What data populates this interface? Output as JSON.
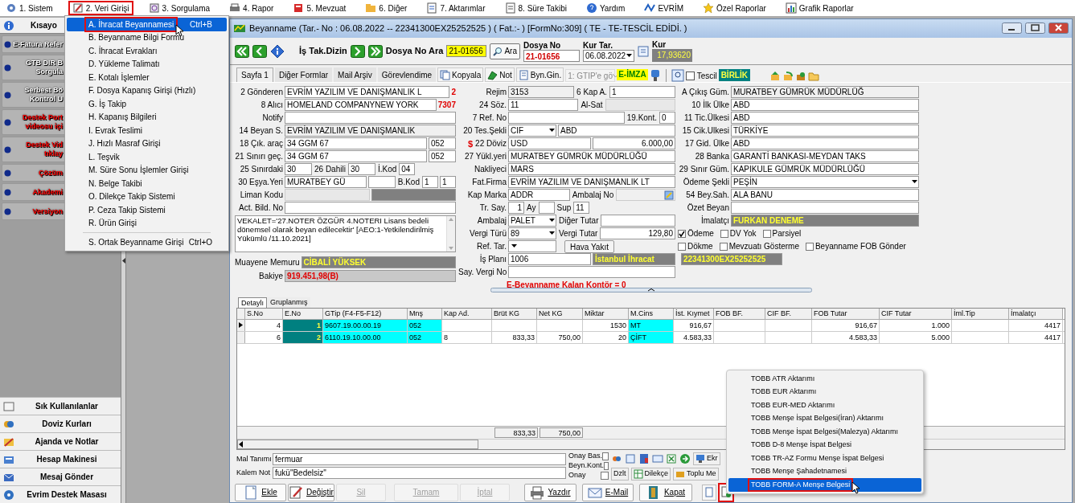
{
  "menubar": [
    {
      "label": "1.  Sistem",
      "selected": false
    },
    {
      "label": "2.  Veri Girişi",
      "selected": true
    },
    {
      "label": "3.  Sorgulama",
      "selected": false
    },
    {
      "label": "4.  Rapor",
      "selected": false
    },
    {
      "label": "5.  Mevzuat",
      "selected": false
    },
    {
      "label": "6.  Diğer",
      "selected": false
    },
    {
      "label": "7.  Aktarımlar",
      "selected": false
    },
    {
      "label": "8. Süre Takibi",
      "selected": false
    },
    {
      "label": "Yardım",
      "selected": false
    },
    {
      "label": "EVRİM",
      "selected": false
    },
    {
      "label": "Özel Raporlar",
      "selected": false
    },
    {
      "label": "Grafik Raporlar",
      "selected": false
    }
  ],
  "sidebar": {
    "title": "Kısayo",
    "items": [
      {
        "lines": [
          "E-Fatura Refer"
        ],
        "color": "#ffffff"
      },
      {
        "lines": [
          "GTB DIR B",
          "Sorgula"
        ],
        "color": "#ffffff"
      },
      {
        "lines": [
          "Serbest Bö",
          "Kontrol U"
        ],
        "color": "#ffffff"
      },
      {
        "lines": [
          "Destek Port",
          "videosu içi"
        ],
        "color": "#ff0000"
      },
      {
        "lines": [
          "Destek Vid",
          "tıklay"
        ],
        "color": "#ff0000"
      },
      {
        "lines": [
          "Çözüm"
        ],
        "color": "#ff0000"
      },
      {
        "lines": [
          "Akademi"
        ],
        "color": "#ff0000"
      },
      {
        "lines": [
          "Versiyon"
        ],
        "color": "#ff0000"
      }
    ],
    "bottom_items": [
      "Sık Kullanılanlar",
      "Doviz Kurları",
      "Ajanda ve Notlar",
      "Hesap Makinesi",
      "Mesaj Gönder",
      "Evrim Destek Masası"
    ]
  },
  "dropdown_menu": {
    "items": [
      {
        "key": "A.",
        "label": "İhracat Beyannamesi",
        "shortcut": "Ctrl+B",
        "selected": true
      },
      {
        "key": "B.",
        "label": "Beyanname Bilgi Formu",
        "selected": false
      },
      {
        "key": "C.",
        "label": "İhracat Evrakları",
        "selected": false
      },
      {
        "key": "D.",
        "label": "Yükleme Talimatı",
        "selected": false
      },
      {
        "key": "E.",
        "label": "Kotalı İşlemler",
        "selected": false
      },
      {
        "key": "F.",
        "label": "Dosya Kapanış Girişi (Hızlı)",
        "selected": false
      },
      {
        "key": "G.",
        "label": "İş Takip",
        "selected": false
      },
      {
        "key": "H.",
        "label": "Kapanış Bilgileri",
        "selected": false
      },
      {
        "key": "I.",
        "label": "Evrak Teslimi",
        "selected": false
      },
      {
        "key": "J.",
        "label": "Hızlı Masraf Girişi",
        "selected": false
      },
      {
        "key": "L.",
        "label": "Teşvik",
        "selected": false
      },
      {
        "key": "M.",
        "label": "Süre Sonu İşlemler Girişi",
        "selected": false
      },
      {
        "key": "N.",
        "label": "Belge Takibi",
        "selected": false
      },
      {
        "key": "O.",
        "label": "Dilekçe Takip Sistemi",
        "selected": false
      },
      {
        "key": "P.",
        "label": "Ceza Takip Sistemi",
        "selected": false
      },
      {
        "key": "R.",
        "label": "Ürün Girişi",
        "selected": false
      }
    ],
    "extra_items": [
      {
        "key": "S.",
        "label": "Ortak Beyanname Girişi",
        "shortcut": "Ctrl+O",
        "selected": false
      }
    ]
  },
  "window": {
    "title": "Beyanname (Tar.- No : 06.08.2022 -- 22341300EX25252525 ) ( Fat.:- )  [FormNo:309] ( TE - TE-TESCİL EDİDİ. )",
    "toolbar": {
      "dizin_label": "İş Tak.Dizin",
      "search_label": "Dosya No Ara",
      "search_value": "21-01656",
      "search_button": "Ara",
      "dosya_label": "Dosya No",
      "dosya_value": "21-01656",
      "kur_tar_label": "Kur Tar.",
      "kur_tar_value": "06.08.2022",
      "kur_label": "Kur",
      "kur_value": "17,93620"
    },
    "form_tabs": [
      {
        "label": "Sayfa 1",
        "selected": true
      },
      {
        "label": "Diğer Formlar",
        "selected": false
      },
      {
        "label": "Mail Arşiv",
        "selected": false
      },
      {
        "label": "Görevlendime",
        "selected": false
      }
    ],
    "form_tools": {
      "copy": "Kopyala",
      "note": "Not",
      "byn": "Byn.Gin.",
      "sort_combo": "1: GTIP'e gö",
      "eimza": "E-İMZA",
      "tescil": "Tescil",
      "tescil_checked": false,
      "birlik": "BİRLİK"
    },
    "columns": [
      [
        [
          {
            "kind": "label",
            "text": "2 Gönderen"
          },
          {
            "kind": "field",
            "value": "EVRİM YAZILIM VE DANIŞMANLIK L"
          },
          {
            "kind": "note",
            "text": "2"
          }
        ],
        [
          {
            "kind": "label",
            "text": "8 Alıcı"
          },
          {
            "kind": "field",
            "value": "HOMELAND COMPANYNEW YORK"
          },
          {
            "kind": "note",
            "text": "7307"
          }
        ],
        [
          {
            "kind": "label",
            "text": "Notify"
          },
          {
            "kind": "field"
          }
        ],
        [
          {
            "kind": "label",
            "text": "14 Beyan S."
          },
          {
            "kind": "readonly",
            "value": "EVRİM YAZILIM VE DANIŞMANLIK"
          }
        ],
        [
          {
            "kind": "label",
            "text": "18 Çık. araç"
          },
          {
            "kind": "field",
            "value": "34 GGM 67"
          },
          {
            "kind": "short",
            "value": "052"
          }
        ],
        [
          {
            "kind": "label",
            "text": "21 Sınırı geç."
          },
          {
            "kind": "field",
            "value": "34 GGM 67"
          },
          {
            "kind": "short",
            "value": "052"
          }
        ],
        [
          {
            "kind": "label",
            "text": "25 Sınırdaki"
          },
          {
            "kind": "short",
            "value": "30"
          },
          {
            "kind": "label",
            "text": "26 Dahili"
          },
          {
            "kind": "short",
            "value": "30"
          },
          {
            "kind": "label",
            "text": "İ.Kod"
          },
          {
            "kind": "tiny",
            "value": "04"
          }
        ],
        [
          {
            "kind": "label",
            "text": "30 Eşya.Yeri"
          },
          {
            "kind": "field",
            "value": "MURATBEY GÜ"
          },
          {
            "kind": "short"
          },
          {
            "kind": "label",
            "text": "B.Kod"
          },
          {
            "kind": "tiny",
            "value": "1"
          },
          {
            "kind": "tiny",
            "value": "1"
          }
        ],
        [
          {
            "kind": "label",
            "text": "Liman Kodu"
          },
          {
            "kind": "disabled"
          },
          {
            "kind": "dark"
          }
        ],
        [
          {
            "kind": "label",
            "text": "Act. Bild. No"
          },
          {
            "kind": "field"
          }
        ],
        [
          {
            "kind": "textarea",
            "value": "VEKALET='27.NOTER ÖZGÜR 4.NOTERI Lisans bedeli dönemsel olarak beyan edilecektir' [AEO:1-Yetkilendirilmiş Yükümlü /11.10.2021]"
          }
        ],
        [
          {
            "kind": "label",
            "text": "Muayene Memuru"
          },
          {
            "kind": "dark",
            "value": "CİBALİ YÜKSEK"
          }
        ],
        [
          {
            "kind": "label",
            "text": "Bakiye"
          },
          {
            "kind": "balance",
            "value": "919.451,98(B)"
          }
        ]
      ],
      [
        [
          {
            "kind": "label",
            "text": "Rejim"
          },
          {
            "kind": "readonly",
            "value": "3153"
          },
          {
            "kind": "label",
            "text": "6 Kap A."
          },
          {
            "kind": "field",
            "value": "1"
          }
        ],
        [
          {
            "kind": "label",
            "text": "24 Söz."
          },
          {
            "kind": "field",
            "value": "11"
          },
          {
            "kind": "label",
            "text": "Al-Sat"
          },
          {
            "kind": "disabled"
          }
        ],
        [
          {
            "kind": "label",
            "text": "7 Ref. No"
          },
          {
            "kind": "field"
          },
          {
            "kind": "label",
            "text": "19.Kont."
          },
          {
            "kind": "tiny",
            "value": "0"
          }
        ],
        [
          {
            "kind": "label",
            "text": "20 Tes.Şekli"
          },
          {
            "kind": "combo",
            "value": "CIF"
          },
          {
            "kind": "field",
            "value": "ABD"
          }
        ],
        [
          {
            "kind": "label",
            "text": "22 Döviz",
            "prefix": "$"
          },
          {
            "kind": "field",
            "value": "USD"
          },
          {
            "kind": "number",
            "value": "6.000,00"
          }
        ],
        [
          {
            "kind": "label",
            "text": "27 Yükl.yeri"
          },
          {
            "kind": "field",
            "value": "MURATBEY GÜMRÜK MÜDÜRLÜĞÜ"
          }
        ],
        [
          {
            "kind": "label",
            "text": "Nakliyeci"
          },
          {
            "kind": "field",
            "value": "MARS"
          }
        ],
        [
          {
            "kind": "label",
            "text": "Fat.Firma"
          },
          {
            "kind": "field",
            "value": "EVRİM YAZILIM VE DANIŞMANLIK LT"
          }
        ],
        [
          {
            "kind": "label",
            "text": "Kap Marka"
          },
          {
            "kind": "field",
            "value": "ADDR"
          },
          {
            "kind": "label",
            "text": "Ambalaj No"
          },
          {
            "kind": "icon_field"
          }
        ],
        [
          {
            "kind": "label",
            "text": "Tr. Say."
          },
          {
            "kind": "tinynum",
            "value": "1"
          },
          {
            "kind": "label",
            "text": "Ay"
          },
          {
            "kind": "tiny"
          },
          {
            "kind": "label",
            "text": "Sup"
          },
          {
            "kind": "tiny",
            "value": "11"
          }
        ],
        [
          {
            "kind": "label",
            "text": "Ambalaj"
          },
          {
            "kind": "combo",
            "value": "PALET"
          },
          {
            "kind": "label",
            "text": "Diğer Tutar"
          },
          {
            "kind": "field"
          }
        ],
        [
          {
            "kind": "label",
            "text": "Vergi Türü"
          },
          {
            "kind": "combo",
            "value": "89"
          },
          {
            "kind": "label",
            "text": "Vergi Tutar"
          },
          {
            "kind": "number",
            "value": "129,80"
          }
        ],
        [
          {
            "kind": "label",
            "text": "Ref. Tar."
          },
          {
            "kind": "combo"
          },
          {
            "kind": "button",
            "text": "Hava Yakıt"
          }
        ],
        [
          {
            "kind": "label",
            "text": "İş Planı"
          },
          {
            "kind": "field",
            "value": "1006"
          },
          {
            "kind": "dark",
            "value": "İstanbul İhracat"
          }
        ],
        [
          {
            "kind": "label",
            "text": "Say. Vergi No"
          },
          {
            "kind": "field"
          }
        ],
        [
          {
            "kind": "note",
            "text": "E-Beyanname Kalan Kontör = 0"
          }
        ]
      ],
      [
        [
          {
            "kind": "label",
            "text": "A Çıkış Güm."
          },
          {
            "kind": "readonly",
            "value": "MURATBEY GÜMRÜK MÜDÜRLÜĞ"
          }
        ],
        [
          {
            "kind": "label",
            "text": "10 İlk Ülke"
          },
          {
            "kind": "field",
            "value": "ABD"
          }
        ],
        [
          {
            "kind": "label",
            "text": "11 Tic.Ülkesi"
          },
          {
            "kind": "field",
            "value": "ABD"
          }
        ],
        [
          {
            "kind": "label",
            "text": "15 Cik.Ulkesi"
          },
          {
            "kind": "field",
            "value": "TÜRKİYE"
          }
        ],
        [
          {
            "kind": "label",
            "text": "17 Gid. Ülke"
          },
          {
            "kind": "field",
            "value": "ABD"
          }
        ],
        [
          {
            "kind": "label",
            "text": "28 Banka"
          },
          {
            "kind": "field",
            "value": "GARANTİ BANKASI-MEYDAN TAKS"
          }
        ],
        [
          {
            "kind": "label",
            "text": "29 Sınır Güm."
          },
          {
            "kind": "field",
            "value": "KAPIKULE GÜMRÜK MÜDÜRLÜĞÜ"
          }
        ],
        [
          {
            "kind": "label",
            "text": "Ödeme Şekli"
          },
          {
            "kind": "combo",
            "value": "PEŞİN"
          }
        ],
        [
          {
            "kind": "label",
            "text": "54 Bey.Sah."
          },
          {
            "kind": "field",
            "value": "ALA BANU"
          }
        ],
        [
          {
            "kind": "label",
            "text": "Özet Beyan"
          },
          {
            "kind": "field"
          }
        ],
        [
          {
            "kind": "label",
            "text": "İmalatçı"
          },
          {
            "kind": "dark",
            "value": "FURKAN DENEME"
          }
        ],
        [
          {
            "kind": "check",
            "text": "Ödeme",
            "checked": true
          },
          {
            "kind": "check",
            "text": "DV Yok",
            "checked": false
          },
          {
            "kind": "check",
            "text": "Parsiyel",
            "checked": false
          }
        ],
        [
          {
            "kind": "check",
            "text": "Dökme",
            "checked": false
          },
          {
            "kind": "check",
            "text": "Mevzuatı Gösterme",
            "checked": false
          },
          {
            "kind": "check",
            "text": "Beyanname FOB Gönder",
            "checked": false
          }
        ],
        [
          {
            "kind": "dark",
            "value": "22341300EX25252525"
          }
        ]
      ]
    ],
    "table_tabs": [
      {
        "label": "Detaylı",
        "selected": true
      },
      {
        "label": "Gruplanmış",
        "selected": false
      }
    ],
    "table": {
      "columns": [
        "S.No",
        "E.No",
        "GTip (F4-F5-F12)",
        "Mnş",
        "Kap Ad.",
        "Brüt KG",
        "Net KG",
        "Miktar",
        "M.Cins",
        "İst. Kıymet",
        "FOB BF.",
        "CIF BF.",
        "FOB Tutar",
        "CIF Tutar",
        "İml.Tip",
        "İmalatçı"
      ],
      "rows": [
        {
          "selected": true,
          "cells": [
            "4",
            "1",
            "9607.19.00.00.19",
            "052",
            null,
            null,
            null,
            "1530",
            "MT",
            "916,67",
            null,
            null,
            "916,67",
            "1.000",
            null,
            "4417"
          ]
        },
        {
          "selected": false,
          "cells": [
            "6",
            "2",
            "6110.19.10.00.00",
            "052",
            "8",
            "833,33",
            "750,00",
            "20",
            "ÇİFT",
            "4.583,33",
            null,
            null,
            "4.583,33",
            "5.000",
            null,
            "4417"
          ]
        }
      ],
      "totals": [
        "833,33",
        "750,00"
      ]
    },
    "item_fields": [
      {
        "label": "Mal Tanımı",
        "value": "fermuar"
      },
      {
        "label": "Kalem Not",
        "value": "fukü\"Bedelsiz\""
      }
    ],
    "approvals": [
      {
        "label": "Onay Bas.",
        "checked": false
      },
      {
        "label": "Beyn.Kont.",
        "checked": false
      },
      {
        "label": "Onay",
        "checked": false
      }
    ],
    "side_buttons": [
      "Ekr",
      "Dzlt",
      "Dilekçe",
      "Toplu Me"
    ],
    "buttons": [
      {
        "label": "Ekle",
        "disabled": false
      },
      {
        "label": "Değiştir",
        "disabled": false
      },
      {
        "label": "Sil",
        "disabled": true
      },
      {
        "label": "Tamam",
        "disabled": true
      },
      {
        "label": "İptal",
        "disabled": true
      },
      {
        "label": "Yazdır",
        "disabled": false
      },
      {
        "label": "E-Mail",
        "disabled": false
      },
      {
        "label": "Kapat",
        "disabled": false
      }
    ]
  },
  "context_menu": {
    "items": [
      {
        "label": "TOBB ATR Aktarımı",
        "selected": false
      },
      {
        "label": "TOBB EUR Aktarımı",
        "selected": false
      },
      {
        "label": "TOBB EUR-MED Aktarımı",
        "selected": false
      },
      {
        "label": "TOBB Menşe İspat Belgesi(İran) Aktarımı",
        "selected": false
      },
      {
        "label": "TOBB Menşe İspat Belgesi(Malezya) Aktarımı",
        "selected": false
      },
      {
        "label": "TOBB D-8 Menşe İspat Belgesi",
        "selected": false
      },
      {
        "label": "TOBB TR-AZ Formu Menşe İspat Belgesi",
        "selected": false
      },
      {
        "label": "TOBB Menşe Şahadetnamesi",
        "selected": false
      },
      {
        "label": "TOBB FORM-A Menşe Belgesi",
        "selected": true
      }
    ]
  }
}
